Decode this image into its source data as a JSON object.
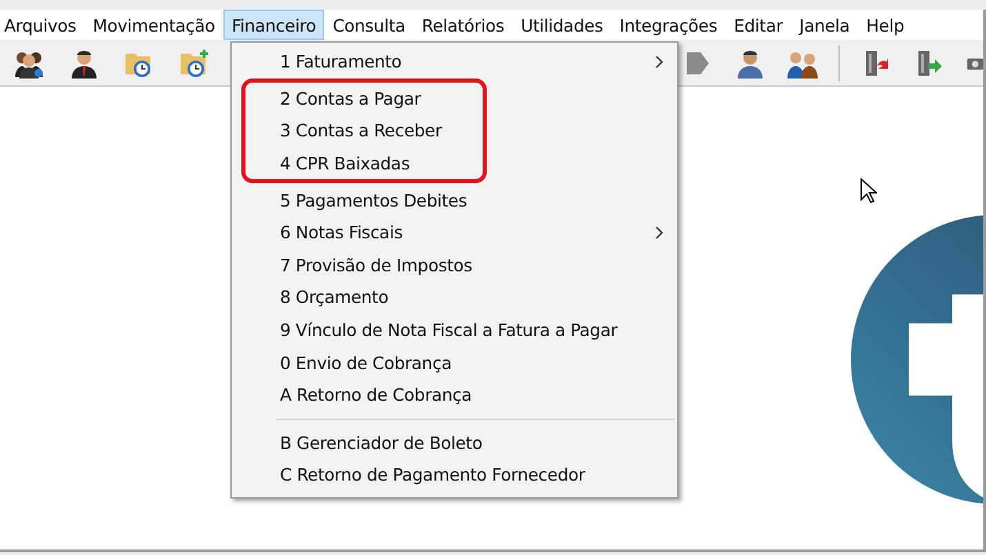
{
  "menu_bar": {
    "items": [
      {
        "label": "Arquivos",
        "selected": false
      },
      {
        "label": "Movimentação",
        "selected": false
      },
      {
        "label": "Financeiro",
        "selected": true
      },
      {
        "label": "Consulta",
        "selected": false
      },
      {
        "label": "Relatórios",
        "selected": false
      },
      {
        "label": "Utilidades",
        "selected": false
      },
      {
        "label": "Integrações",
        "selected": false
      },
      {
        "label": "Editar",
        "selected": false
      },
      {
        "label": "Janela",
        "selected": false
      },
      {
        "label": "Help",
        "selected": false
      }
    ]
  },
  "dropdown": {
    "items": [
      {
        "kind": "item",
        "label": "1 Faturamento",
        "submenu": true,
        "highlighted": false
      },
      {
        "kind": "item",
        "label": "2 Contas a Pagar",
        "submenu": false,
        "highlighted": true
      },
      {
        "kind": "item",
        "label": "3 Contas a Receber",
        "submenu": false,
        "highlighted": true
      },
      {
        "kind": "item",
        "label": "4 CPR Baixadas",
        "submenu": false,
        "highlighted": true
      },
      {
        "kind": "item",
        "label": "5 Pagamentos Debites",
        "submenu": false,
        "highlighted": false
      },
      {
        "kind": "item",
        "label": "6 Notas Fiscais",
        "submenu": true,
        "highlighted": false
      },
      {
        "kind": "item",
        "label": "7 Provisão de Impostos",
        "submenu": false,
        "highlighted": false
      },
      {
        "kind": "item",
        "label": "8 Orçamento",
        "submenu": false,
        "highlighted": false
      },
      {
        "kind": "item",
        "label": "9 Vínculo de Nota Fiscal a Fatura a Pagar",
        "submenu": false,
        "highlighted": false
      },
      {
        "kind": "item",
        "label": "0 Envio de Cobrança",
        "submenu": false,
        "highlighted": false
      },
      {
        "kind": "item",
        "label": "A Retorno de Cobrança",
        "submenu": false,
        "highlighted": false
      },
      {
        "kind": "separator"
      },
      {
        "kind": "item",
        "label": "B Gerenciador de Boleto",
        "submenu": false,
        "highlighted": false
      },
      {
        "kind": "item",
        "label": "C Retorno de Pagamento Fornecedor",
        "submenu": false,
        "highlighted": false
      }
    ]
  }
}
